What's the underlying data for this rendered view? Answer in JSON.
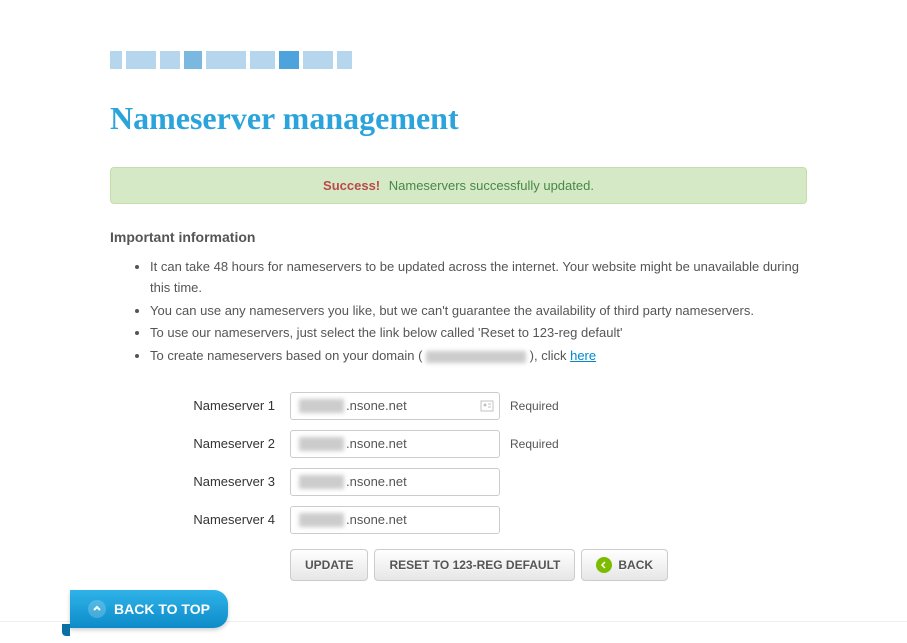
{
  "page": {
    "title": "Nameserver management"
  },
  "alert": {
    "success_label": "Success!",
    "message": "Nameservers successfully updated."
  },
  "info": {
    "heading": "Important information",
    "items": [
      "It can take 48 hours for nameservers to be updated across the internet. Your website might be unavailable during this time.",
      "You can use any nameservers you like, but we can't guarantee the availability of third party nameservers.",
      "To use our nameservers, just select the link below called 'Reset to 123-reg default'"
    ],
    "item4_prefix": "To create nameservers based on your domain ( ",
    "item4_suffix": " ), click ",
    "item4_link": "here"
  },
  "form": {
    "fields": [
      {
        "label": "Nameserver 1",
        "value": ".nsone.net",
        "required": "Required"
      },
      {
        "label": "Nameserver 2",
        "value": ".nsone.net",
        "required": "Required"
      },
      {
        "label": "Nameserver 3",
        "value": ".nsone.net",
        "required": ""
      },
      {
        "label": "Nameserver 4",
        "value": ".nsone.net",
        "required": ""
      }
    ],
    "buttons": {
      "update": "UPDATE",
      "reset": "RESET TO 123-REG DEFAULT",
      "back": "BACK"
    }
  },
  "footer": {
    "back_to_top": "BACK TO TOP"
  }
}
